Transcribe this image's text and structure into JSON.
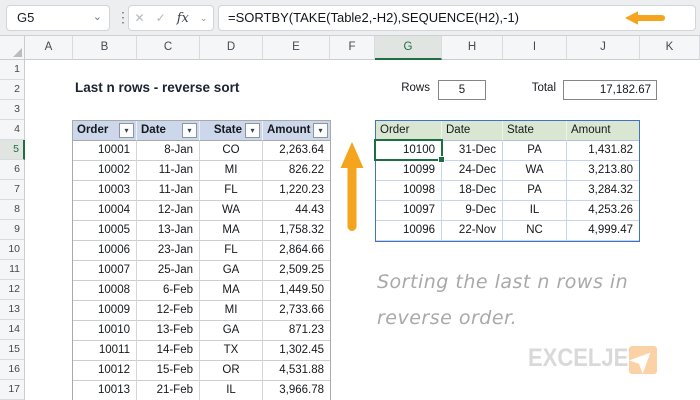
{
  "chrome": {
    "name_box": "G5",
    "dots": "⋮",
    "cancel_icon": "✕",
    "enter_icon": "✓",
    "fx_label": "fx",
    "formula": "=SORTBY(TAKE(Table2,-H2),SEQUENCE(H2),-1)"
  },
  "grid": {
    "columns": [
      "A",
      "B",
      "C",
      "D",
      "E",
      "F",
      "G",
      "H",
      "I",
      "J",
      "K"
    ],
    "selected_column": "G",
    "rows": [
      "1",
      "2",
      "3",
      "4",
      "5",
      "6",
      "7",
      "8",
      "9",
      "10",
      "11",
      "12",
      "13",
      "14",
      "15",
      "16",
      "17"
    ],
    "selected_row": "5",
    "selected_cell": "G5"
  },
  "sheet": {
    "title": "Last n rows - reverse sort",
    "rows_label": "Rows",
    "rows_value": "5",
    "total_label": "Total",
    "total_value": "17,182.67"
  },
  "source_table": {
    "headers": [
      "Order",
      "Date",
      "State",
      "Amount"
    ],
    "rows": [
      [
        "10001",
        "8-Jan",
        "CO",
        "2,263.64"
      ],
      [
        "10002",
        "11-Jan",
        "MI",
        "826.22"
      ],
      [
        "10003",
        "11-Jan",
        "FL",
        "1,220.23"
      ],
      [
        "10004",
        "12-Jan",
        "WA",
        "44.43"
      ],
      [
        "10005",
        "13-Jan",
        "MA",
        "1,758.32"
      ],
      [
        "10006",
        "23-Jan",
        "FL",
        "2,864.66"
      ],
      [
        "10007",
        "25-Jan",
        "GA",
        "2,509.25"
      ],
      [
        "10008",
        "6-Feb",
        "MA",
        "1,449.50"
      ],
      [
        "10009",
        "12-Feb",
        "MI",
        "2,733.66"
      ],
      [
        "10010",
        "13-Feb",
        "GA",
        "871.23"
      ],
      [
        "10011",
        "14-Feb",
        "TX",
        "1,302.45"
      ],
      [
        "10012",
        "15-Feb",
        "OR",
        "4,531.88"
      ],
      [
        "10013",
        "21-Feb",
        "IL",
        "3,966.78"
      ]
    ]
  },
  "result_table": {
    "headers": [
      "Order",
      "Date",
      "State",
      "Amount"
    ],
    "rows": [
      [
        "10100",
        "31-Dec",
        "PA",
        "1,431.82"
      ],
      [
        "10099",
        "24-Dec",
        "WA",
        "3,213.80"
      ],
      [
        "10098",
        "18-Dec",
        "PA",
        "3,284.32"
      ],
      [
        "10097",
        "9-Dec",
        "IL",
        "4,253.26"
      ],
      [
        "10096",
        "22-Nov",
        "NC",
        "4,999.47"
      ]
    ],
    "selected_cell_value": "10100"
  },
  "annotation": {
    "line1": "Sorting the last n rows in",
    "line2": "reverse order."
  },
  "logo": {
    "text": "EXCELJET"
  },
  "colors": {
    "accent_green": "#1d6f42",
    "source_header_blue": "#ccd7eb",
    "result_header_green": "#d9e7d2",
    "result_border_blue": "#3f74c1",
    "arrow_orange": "#f5a41d",
    "logo_orange": "#fbd2a6"
  }
}
